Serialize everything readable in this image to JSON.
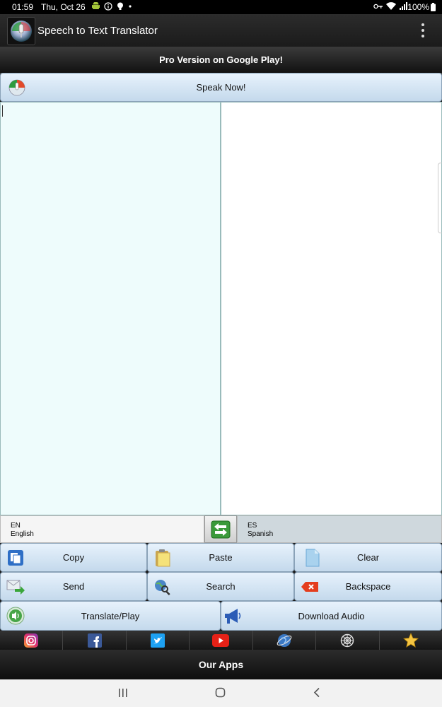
{
  "status_bar": {
    "time": "01:59",
    "date": "Thu, Oct 26",
    "battery": "100%"
  },
  "app_bar": {
    "title": "Speech to Text Translator"
  },
  "pro_banner": "Pro Version on Google Play!",
  "speak_button": "Speak Now!",
  "source_text": "",
  "translated_text": "",
  "languages": {
    "source": {
      "code": "EN",
      "name": "English"
    },
    "target": {
      "code": "ES",
      "name": "Spanish"
    }
  },
  "actions": {
    "copy": "Copy",
    "paste": "Paste",
    "clear": "Clear",
    "send": "Send",
    "search": "Search",
    "backspace": "Backspace",
    "translate_play": "Translate/Play",
    "download_audio": "Download Audio"
  },
  "social": [
    "instagram-icon",
    "facebook-icon",
    "twitter-icon",
    "youtube-icon",
    "web-icon",
    "settings-icon",
    "star-icon"
  ],
  "our_apps": "Our Apps",
  "colors": {
    "button_top": "#e7f2fc",
    "button_bottom": "#c4d9ec",
    "source_pane": "#eefcfc",
    "target_lang_bg": "#cfd8dd"
  }
}
